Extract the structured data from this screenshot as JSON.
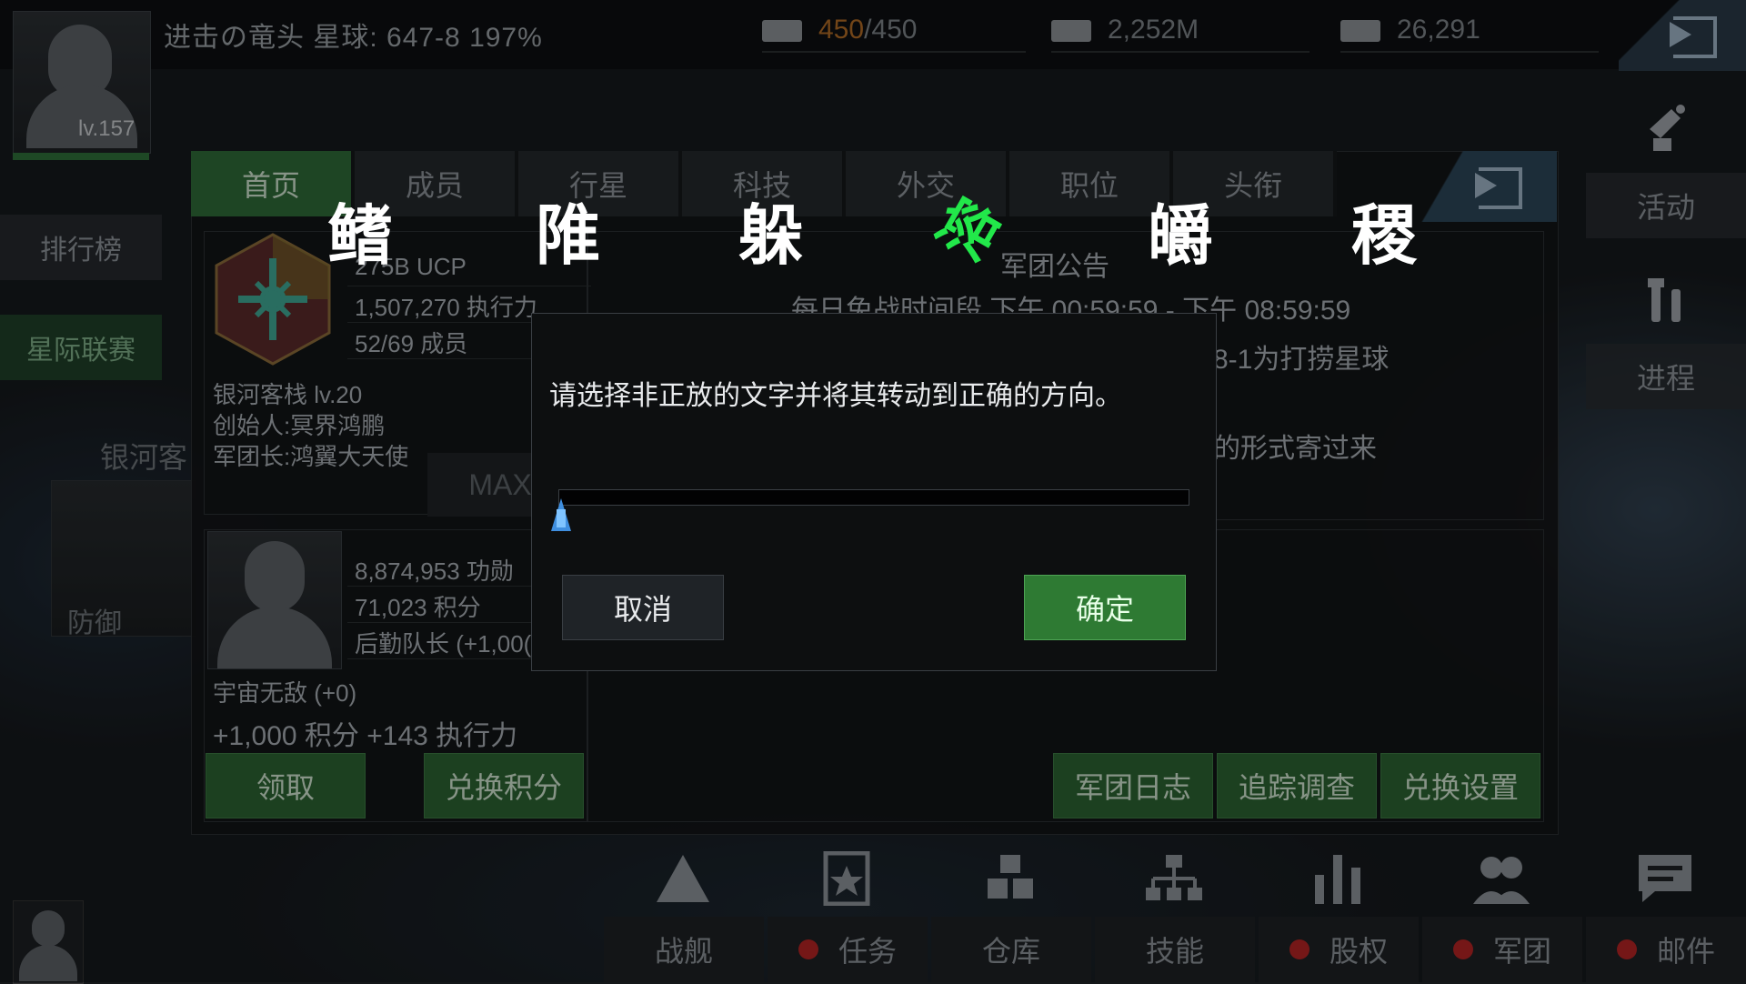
{
  "top_bar": {
    "title": "进击の竜头   星球: 647-8  197%",
    "level": "lv.157",
    "energy_current": "450",
    "energy_max": "/450",
    "money": "2,252M",
    "credits": "26,291"
  },
  "left_menu": {
    "ranking": "排行榜",
    "league": "星际联赛",
    "galaxy_label": "银河客",
    "defense_label": "防御"
  },
  "right_menu": {
    "activity": "活动",
    "progress": "进程"
  },
  "tabs": [
    {
      "label": "首页",
      "active": true
    },
    {
      "label": "成员"
    },
    {
      "label": "行星"
    },
    {
      "label": "科技"
    },
    {
      "label": "外交"
    },
    {
      "label": "职位"
    },
    {
      "label": "头衔"
    }
  ],
  "legion_info": {
    "ucp": "275B UCP",
    "action_power": "1,507,270 执行力",
    "members": "52/69 成员",
    "name_level": "银河客栈 lv.20",
    "founder": "创始人:冥界鸿鹏",
    "leader": "军团长:鸿翼大天使",
    "max_label": "MAX"
  },
  "notice": {
    "title": "军团公告",
    "safe_time": "每日免战时间段 下午 00:59:59 - 下午 08:59:59",
    "line1": "8-1为打捞星球",
    "line2": "的形式寄过来"
  },
  "member": {
    "merit": "8,874,953 功勋",
    "points": "71,023 积分",
    "role": "后勤队长 (+1,00(",
    "name": "宇宙无敌 (+0)",
    "reward": "+1,000 积分  +143 执行力",
    "claim_button": "领取",
    "exchange_button": "兑换积分"
  },
  "legion_actions": {
    "log": "军团日志",
    "track": "追踪调查",
    "exchange_settings": "兑换设置"
  },
  "captcha": {
    "chars": [
      "鳍",
      "陮",
      "躲",
      "溶",
      "皭",
      "稷"
    ],
    "rotated_index": 3,
    "prompt": "请选择非正放的文字并将其转动到正确的方向。",
    "cancel": "取消",
    "confirm": "确定",
    "slider_value": 0
  },
  "bottom_nav": [
    {
      "label": "战舰",
      "dot": false
    },
    {
      "label": "任务",
      "dot": true
    },
    {
      "label": "仓库",
      "dot": false
    },
    {
      "label": "技能",
      "dot": false
    },
    {
      "label": "股权",
      "dot": true
    },
    {
      "label": "军团",
      "dot": true
    },
    {
      "label": "邮件",
      "dot": true
    }
  ],
  "colors": {
    "accent_green": "#2e7a33",
    "alert_red": "#b42424",
    "captcha_green": "#22e84a",
    "slider_blue": "#3f8fe0"
  }
}
